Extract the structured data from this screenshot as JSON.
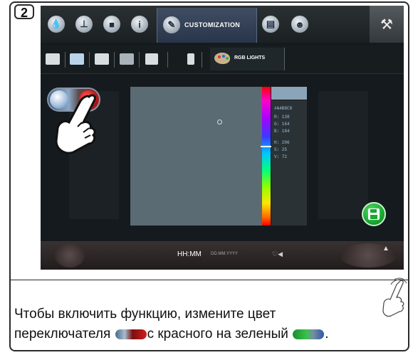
{
  "step_number": "2",
  "top_bar": {
    "customization_label": "CUSTOMIZATION",
    "icons": [
      "water-drop-icon",
      "thermometer-icon",
      "steam-icon",
      "info-icon",
      "pencil-icon",
      "screen-icon",
      "user-icon",
      "wrench-icon"
    ]
  },
  "sub_bar": {
    "rgb_lights_label": "RGB LIGHTS",
    "icons": [
      "book-icon",
      "book-highlight-icon",
      "image-icon",
      "screen-saver-icon",
      "speaker-icon",
      "bottle-icon",
      "palette-icon"
    ]
  },
  "color_panel": {
    "values": [
      "#A4B8C8",
      "R: 138",
      "G: 164",
      "B: 184",
      "H: 206",
      "S: 25",
      "V: 72"
    ]
  },
  "status_bar": {
    "time": "HH:MM",
    "date": "DD.MM.YYYY"
  },
  "instruction": {
    "part1": "Чтобы включить функцию, измените цвет",
    "part2": "переключателя",
    "part3": "с красного на зеленый",
    "part4": "."
  },
  "colors": {
    "toggle_off": "#b01818",
    "toggle_on": "#19a831",
    "save_button": "#19a831"
  }
}
